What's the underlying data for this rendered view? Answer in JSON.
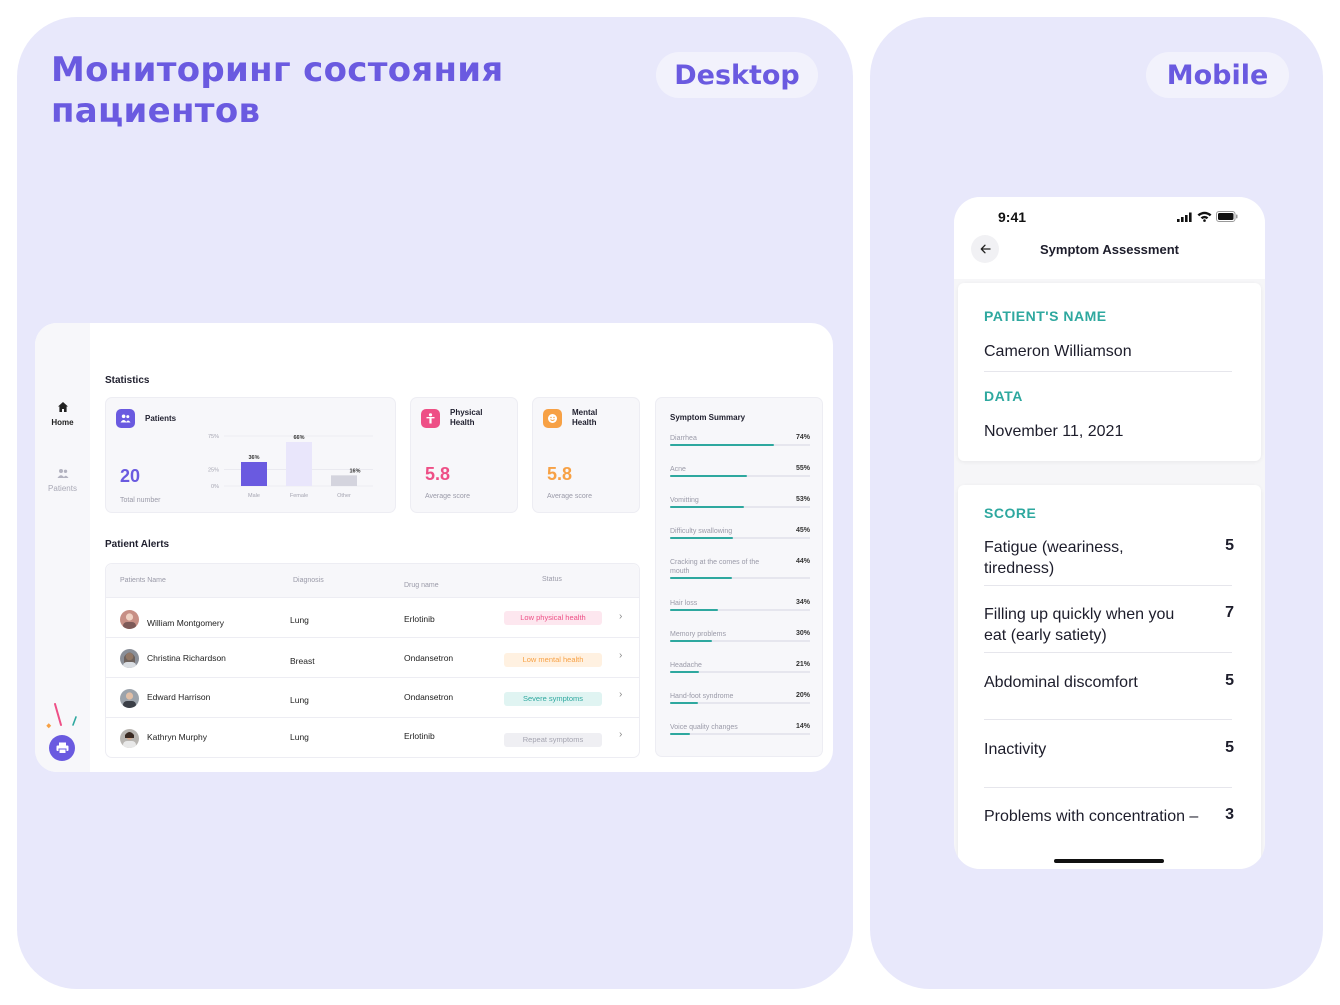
{
  "page": {
    "title_line1": "Мониторинг состояния",
    "title_line2": "пациентов",
    "desktop_label": "Desktop",
    "mobile_label": "Mobile"
  },
  "colors": {
    "accent": "#6a5ae0",
    "teal": "#2ea89f",
    "pink": "#ee4f86",
    "orange": "#f7a145",
    "panel_bg": "#e8e8fb"
  },
  "dashboard": {
    "nav": [
      {
        "label": "Home",
        "icon": "home-icon",
        "active": true
      },
      {
        "label": "Patients",
        "icon": "users-icon",
        "active": false
      }
    ],
    "statistics_title": "Statistics",
    "patients_card": {
      "label": "Patients",
      "total": "20",
      "total_caption": "Total number"
    },
    "chart_data": {
      "type": "bar",
      "categories": [
        "Male",
        "Female",
        "Other"
      ],
      "values": [
        36,
        66,
        16
      ],
      "value_labels": [
        "36%",
        "66%",
        "16%"
      ],
      "y_ticks": [
        "75%",
        "25%",
        "0%"
      ],
      "ylim": [
        0,
        75
      ],
      "grid": true
    },
    "physical_card": {
      "label_line1": "Physical",
      "label_line2": "Health",
      "score": "5.8",
      "caption": "Average score"
    },
    "mental_card": {
      "label_line1": "Mental",
      "label_line2": "Health",
      "score": "5.8",
      "caption": "Average score"
    },
    "alerts_title": "Patient Alerts",
    "alerts_headers": [
      "Patients Name",
      "Diagnosis",
      "Drug name",
      "Status"
    ],
    "alerts_rows": [
      {
        "name": "William Montgomery",
        "diagnosis": "Lung",
        "drug": "Erlotinib",
        "status": "Low physical health",
        "status_color": "#ee4f86",
        "status_bg": "#fde7ef"
      },
      {
        "name": "Christina Richardson",
        "diagnosis": "Breast",
        "drug": "Ondansetron",
        "status": "Low mental health",
        "status_color": "#f7a145",
        "status_bg": "#fff1e1"
      },
      {
        "name": "Edward Harrison",
        "diagnosis": "Lung",
        "drug": "Ondansetron",
        "status": "Severe symptoms",
        "status_color": "#2ea89f",
        "status_bg": "#e0f4f2"
      },
      {
        "name": "Kathryn Murphy",
        "diagnosis": "Lung",
        "drug": "Erlotinib",
        "status": "Repeat symptoms",
        "status_color": "#a5a5b1",
        "status_bg": "#efeff3"
      }
    ],
    "symptom_summary": {
      "title": "Symptom Summary",
      "items": [
        {
          "name": "Diarrhea",
          "pct": "74%",
          "value": 74
        },
        {
          "name": "Acne",
          "pct": "55%",
          "value": 55
        },
        {
          "name": "Vomitting",
          "pct": "53%",
          "value": 53
        },
        {
          "name": "Difficulty swallowing",
          "pct": "45%",
          "value": 45
        },
        {
          "name": "Cracking at the comes of the mouth",
          "pct": "44%",
          "value": 44
        },
        {
          "name": "Hair loss",
          "pct": "34%",
          "value": 34
        },
        {
          "name": "Memory problems",
          "pct": "30%",
          "value": 30
        },
        {
          "name": "Headache",
          "pct": "21%",
          "value": 21
        },
        {
          "name": "Hand-foot syndrome",
          "pct": "20%",
          "value": 20
        },
        {
          "name": "Voice quality changes",
          "pct": "14%",
          "value": 14
        }
      ]
    }
  },
  "mobile": {
    "time": "9:41",
    "title": "Symptom Assessment",
    "patient_label": "PATIENT'S NAME",
    "patient_name": "Cameron Williamson",
    "date_label": "DATA",
    "date_value": "November 11, 2021",
    "score_label": "SCORE",
    "scores": [
      {
        "name": "Fatigue (weariness, tiredness)",
        "value": "5"
      },
      {
        "name": "Filling up quickly when you eat (early satiety)",
        "value": "7"
      },
      {
        "name": "Abdominal discomfort",
        "value": "5"
      },
      {
        "name": "Inactivity",
        "value": "5"
      },
      {
        "name": "Problems with concentration –",
        "value": "3"
      }
    ]
  }
}
